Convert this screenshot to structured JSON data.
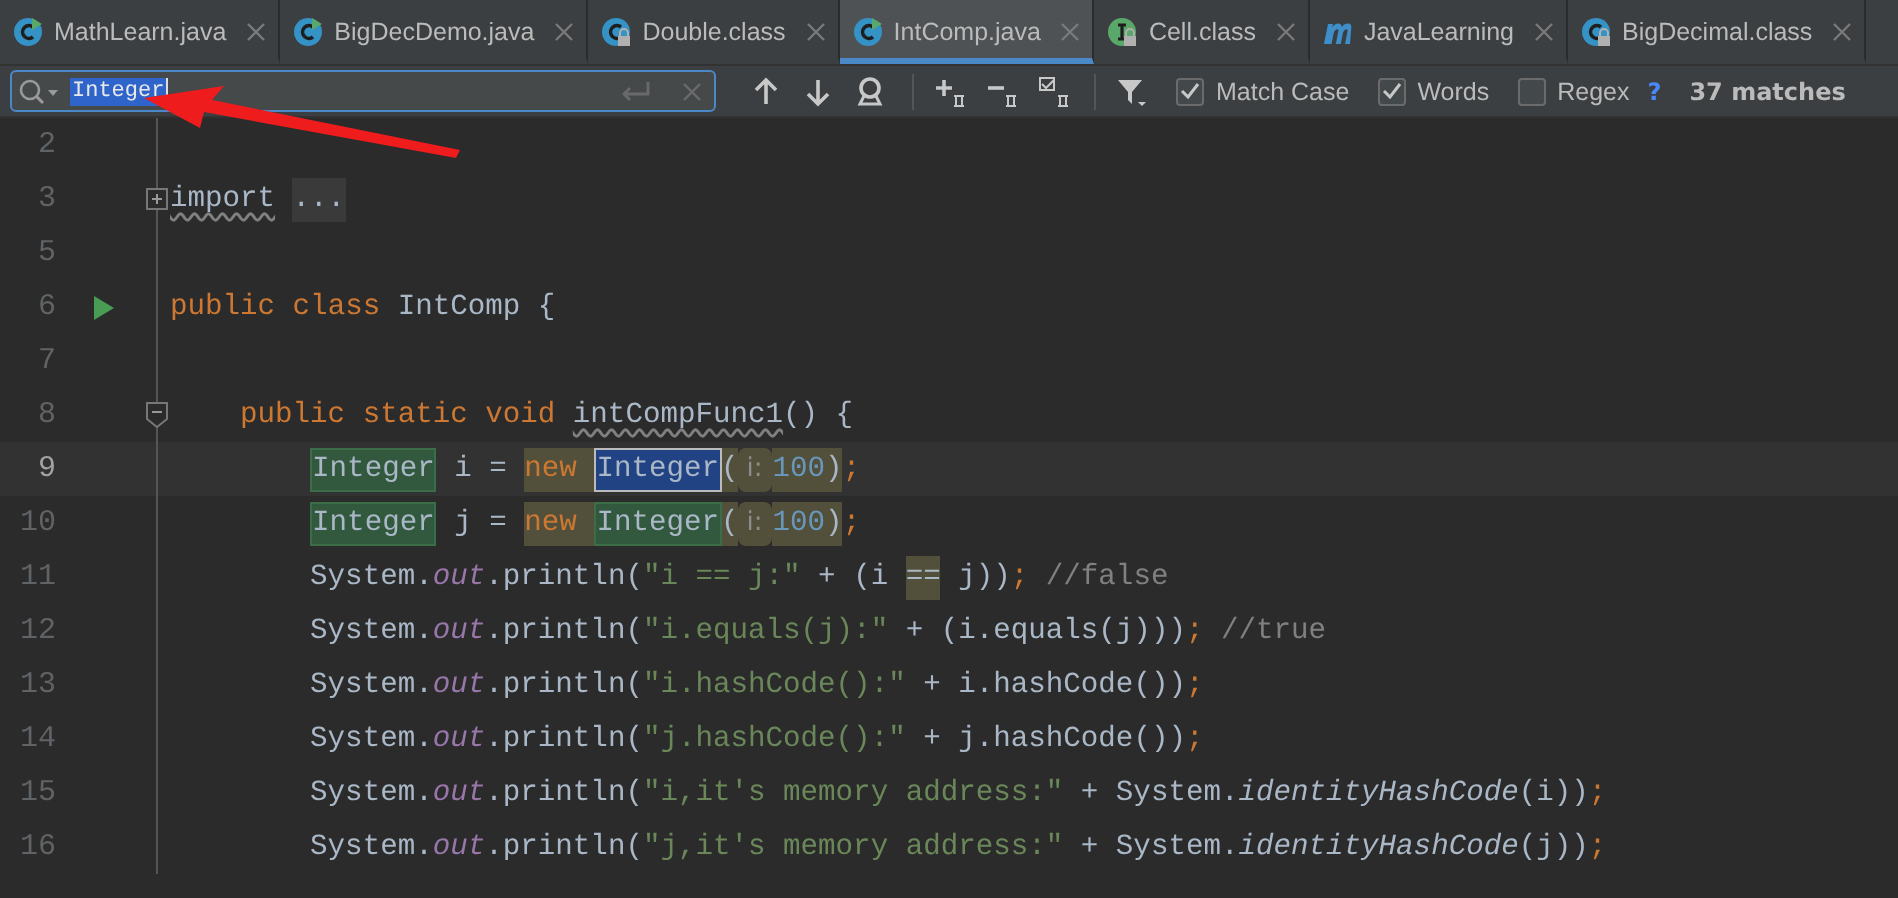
{
  "tabs": [
    {
      "label": "MathLearn.java",
      "kind": "class",
      "selected": false
    },
    {
      "label": "BigDecDemo.java",
      "kind": "class",
      "selected": false
    },
    {
      "label": "Double.class",
      "kind": "locked-class",
      "selected": false
    },
    {
      "label": "IntComp.java",
      "kind": "class",
      "selected": true
    },
    {
      "label": "Cell.class",
      "kind": "locked-interface",
      "selected": false
    },
    {
      "label": "JavaLearning",
      "kind": "module",
      "selected": false
    },
    {
      "label": "BigDecimal.class",
      "kind": "locked-class",
      "selected": false
    }
  ],
  "search": {
    "value": "Integer",
    "options": [
      {
        "label": "Match Case",
        "checked": true
      },
      {
        "label": "Words",
        "checked": true
      },
      {
        "label": "Regex",
        "checked": false
      }
    ],
    "help": "?",
    "matches": "37 matches"
  },
  "editor": {
    "lines": [
      {
        "number": "2"
      },
      {
        "number": "3",
        "expanded": false,
        "tokens": [
          {
            "kind": "unused",
            "text": "import"
          },
          {
            "kind": "folded",
            "text": "..."
          }
        ]
      },
      {
        "number": "5"
      },
      {
        "number": "6",
        "run": true,
        "tokens": [
          {
            "kind": "kw",
            "text": "public class "
          },
          {
            "kind": "plain",
            "text": "IntComp {"
          }
        ],
        "children": [
          {
            "number": "7"
          },
          {
            "number": "8",
            "expanded": true,
            "tokens": [
              {
                "kind": "kw",
                "text": "public static void "
              },
              {
                "kind": "unused",
                "text": "intCompFunc1"
              },
              {
                "kind": "plain",
                "text": "() {"
              }
            ],
            "children": [
              {
                "number": "9",
                "current": true,
                "tokens": [
                  {
                    "kind": "plain",
                    "text": "Integer",
                    "match": true
                  },
                  {
                    "kind": "plain",
                    "text": " i = "
                  },
                  {
                    "kind": "kw",
                    "text": "new ",
                    "usage": true
                  },
                  {
                    "kind": "plain",
                    "text": "Integer",
                    "current": true
                  },
                  {
                    "kind": "plain",
                    "text": "(",
                    "usage": true
                  },
                  {
                    "kind": "hint",
                    "text": "i:",
                    "usage": true
                  },
                  {
                    "kind": "num",
                    "text": "100",
                    "usage": true
                  },
                  {
                    "kind": "plain",
                    "text": ")",
                    "usage": true
                  },
                  {
                    "kind": "punct",
                    "text": ";"
                  }
                ]
              },
              {
                "number": "10",
                "current": false,
                "tokens": [
                  {
                    "kind": "plain",
                    "text": "Integer",
                    "match": true
                  },
                  {
                    "kind": "plain",
                    "text": " j = "
                  },
                  {
                    "kind": "kw",
                    "text": "new ",
                    "usage": true
                  },
                  {
                    "kind": "plain",
                    "text": "Integer",
                    "match": true,
                    "usage": true
                  },
                  {
                    "kind": "plain",
                    "text": "(",
                    "usage": true
                  },
                  {
                    "kind": "hint",
                    "text": "i:",
                    "usage": true
                  },
                  {
                    "kind": "num",
                    "text": "100",
                    "usage": true
                  },
                  {
                    "kind": "plain",
                    "text": ")",
                    "usage": true
                  },
                  {
                    "kind": "punct",
                    "text": ";"
                  }
                ]
              },
              {
                "number": "11",
                "tokens": [
                  {
                    "kind": "plain",
                    "text": "System."
                  },
                  {
                    "kind": "field",
                    "text": "out"
                  },
                  {
                    "kind": "plain",
                    "text": ".println("
                  },
                  {
                    "kind": "str",
                    "text": "\"i == j:\""
                  },
                  {
                    "kind": "plain",
                    "text": " + (i "
                  },
                  {
                    "kind": "plain",
                    "text": "==",
                    "usage": true
                  },
                  {
                    "kind": "plain",
                    "text": " j))"
                  },
                  {
                    "kind": "punct",
                    "text": ";"
                  },
                  {
                    "kind": "comment",
                    "text": "//false"
                  }
                ]
              },
              {
                "number": "12",
                "tokens": [
                  {
                    "kind": "plain",
                    "text": "System."
                  },
                  {
                    "kind": "field",
                    "text": "out"
                  },
                  {
                    "kind": "plain",
                    "text": ".println("
                  },
                  {
                    "kind": "str",
                    "text": "\"i.equals(j):\""
                  },
                  {
                    "kind": "plain",
                    "text": " + (i.equals(j)))"
                  },
                  {
                    "kind": "punct",
                    "text": ";"
                  },
                  {
                    "kind": "comment",
                    "text": "//true"
                  }
                ]
              },
              {
                "number": "13",
                "tokens": [
                  {
                    "kind": "plain",
                    "text": "System."
                  },
                  {
                    "kind": "field",
                    "text": "out"
                  },
                  {
                    "kind": "plain",
                    "text": ".println("
                  },
                  {
                    "kind": "str",
                    "text": "\"i.hashCode():\""
                  },
                  {
                    "kind": "plain",
                    "text": " + i.hashCode())"
                  },
                  {
                    "kind": "punct",
                    "text": ";"
                  }
                ]
              },
              {
                "number": "14",
                "tokens": [
                  {
                    "kind": "plain",
                    "text": "System."
                  },
                  {
                    "kind": "field",
                    "text": "out"
                  },
                  {
                    "kind": "plain",
                    "text": ".println("
                  },
                  {
                    "kind": "str",
                    "text": "\"j.hashCode():\""
                  },
                  {
                    "kind": "plain",
                    "text": " + j.hashCode())"
                  },
                  {
                    "kind": "punct",
                    "text": ";"
                  }
                ]
              },
              {
                "number": "15",
                "tokens": [
                  {
                    "kind": "plain",
                    "text": "System."
                  },
                  {
                    "kind": "field",
                    "text": "out"
                  },
                  {
                    "kind": "plain",
                    "text": ".println("
                  },
                  {
                    "kind": "str",
                    "text": "\"i,it's memory address:\""
                  },
                  {
                    "kind": "plain",
                    "text": " + System."
                  },
                  {
                    "kind": "static",
                    "text": "identityHashCode"
                  },
                  {
                    "kind": "plain",
                    "text": "(i))"
                  },
                  {
                    "kind": "punct",
                    "text": ";"
                  }
                ]
              },
              {
                "number": "16",
                "tokens": [
                  {
                    "kind": "plain",
                    "text": "System."
                  },
                  {
                    "kind": "field",
                    "text": "out"
                  },
                  {
                    "kind": "plain",
                    "text": ".println("
                  },
                  {
                    "kind": "str",
                    "text": "\"j,it's memory address:\""
                  },
                  {
                    "kind": "plain",
                    "text": " + System."
                  },
                  {
                    "kind": "static",
                    "text": "identityHashCode"
                  },
                  {
                    "kind": "plain",
                    "text": "(j))"
                  },
                  {
                    "kind": "punct",
                    "text": ";"
                  }
                ]
              }
            ]
          }
        ]
      }
    ]
  },
  "annotations": [
    {
      "kind": "arrow"
    }
  ]
}
